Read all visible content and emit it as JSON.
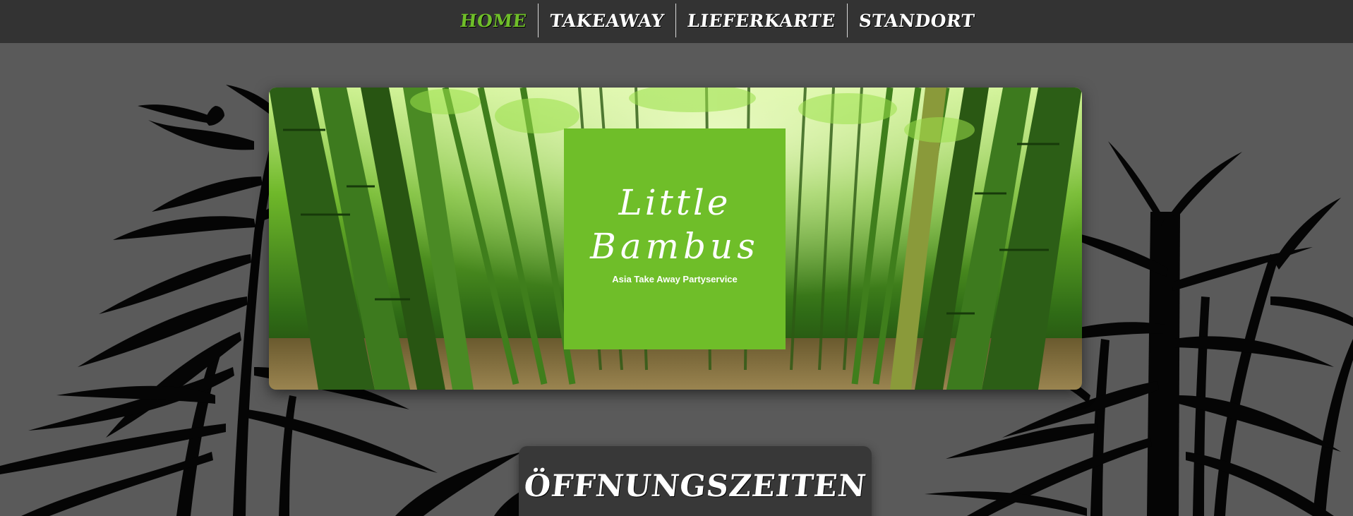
{
  "nav": {
    "items": [
      {
        "label": "HOME",
        "active": true
      },
      {
        "label": "TAKEAWAY",
        "active": false
      },
      {
        "label": "LIEFERKARTE",
        "active": false
      },
      {
        "label": "STANDORT",
        "active": false
      }
    ]
  },
  "hero": {
    "logo": {
      "line1": "Little",
      "line2": "Bambus",
      "tagline": "Asia Take Away Partyservice"
    },
    "image_subject": "bamboo-forest"
  },
  "hours": {
    "title": "ÖFFNUNGSZEITEN"
  },
  "colors": {
    "accent": "#6fbe29",
    "nav_bg": "#333333",
    "page_bg": "#5a5a5a",
    "panel_bg": "#383838"
  }
}
